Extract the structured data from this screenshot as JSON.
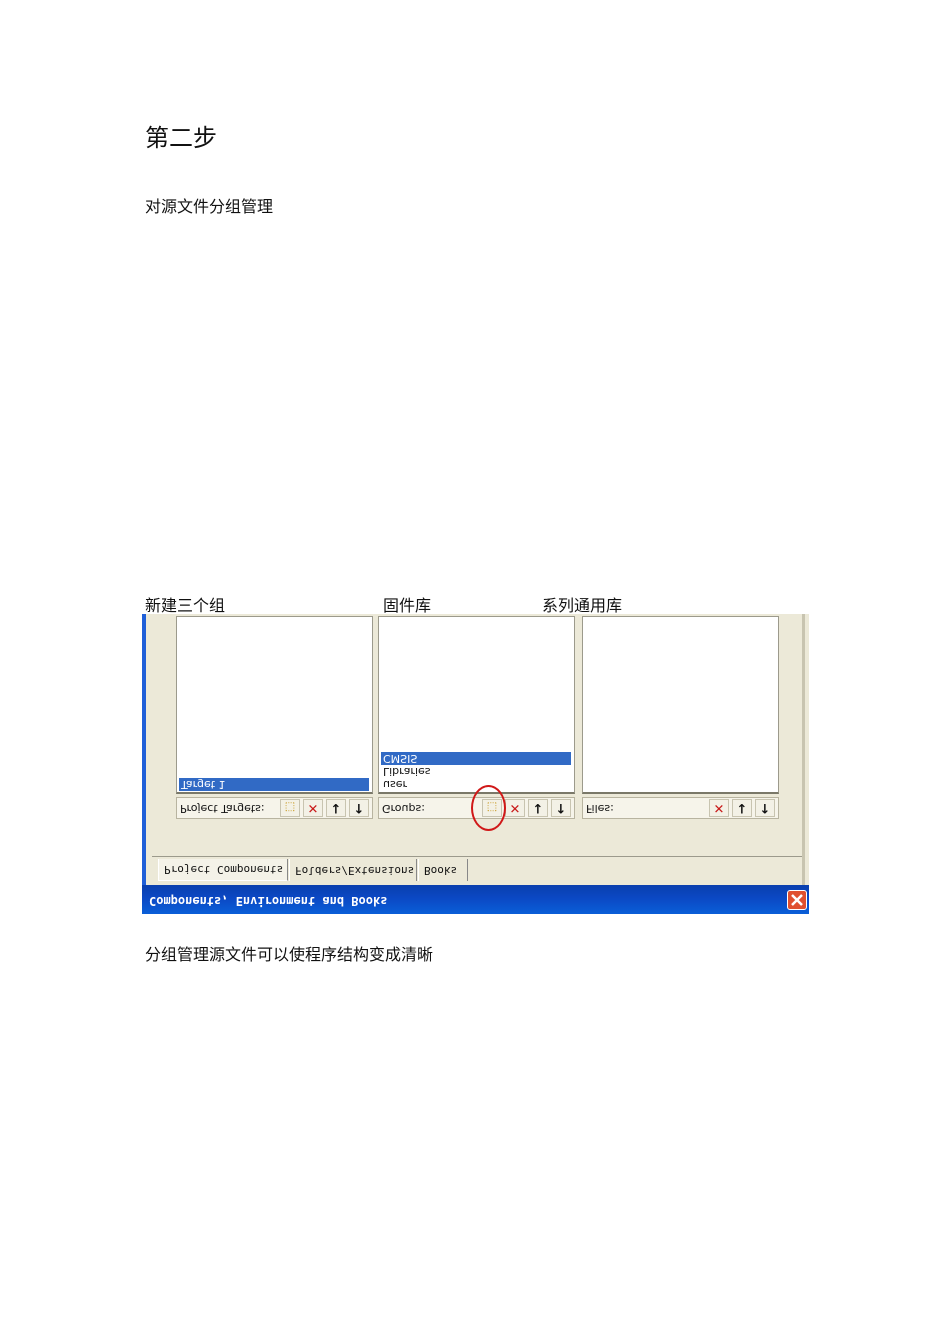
{
  "document": {
    "heading": "第二步",
    "intro": "对源文件分组管理",
    "captions": [
      "新建三个组",
      "固件库",
      "系列通用库"
    ],
    "footer": "分组管理源文件可以使程序结构变成清晰"
  },
  "dialog": {
    "title": "Components, Environment and Books",
    "tabs": [
      "Project Components",
      "Folders/Extensions",
      "Books"
    ],
    "panels": {
      "targets": {
        "label": "Project Targets:",
        "items": [
          "Target 1"
        ]
      },
      "groups": {
        "label": "Groups:",
        "items": [
          "CMSIS",
          "Libraries",
          "user"
        ]
      },
      "files": {
        "label": "Files:",
        "items": []
      }
    },
    "toolbar_icons": [
      "new-icon",
      "delete-icon",
      "move-down-icon",
      "move-up-icon"
    ],
    "colors": {
      "title_bar": "#0b48c4",
      "selection": "#316ac5",
      "highlight_circle": "#d01818",
      "window_face": "#ece9d8"
    }
  }
}
